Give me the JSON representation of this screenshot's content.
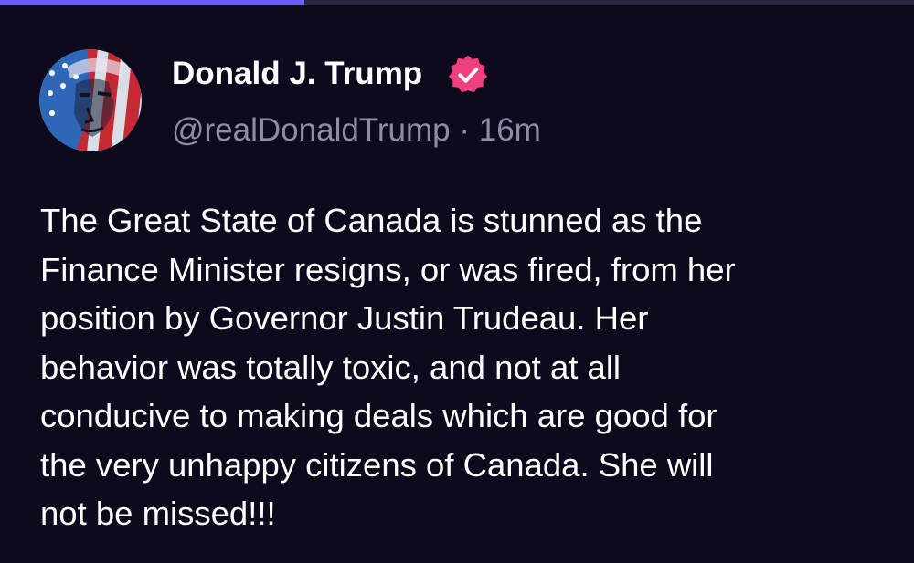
{
  "colors": {
    "background": "#0c0a1c",
    "progress_fill": "#6c5cf0",
    "progress_track": "#2a2840",
    "text_primary": "#ffffff",
    "text_secondary": "#8f8da6",
    "verified_badge": "#ee3f7e"
  },
  "progress": {
    "fraction": 0.333
  },
  "post": {
    "author": {
      "display_name": "Donald J. Trump",
      "handle": "@realDonaldTrump",
      "avatar_icon": "avatar-image",
      "verified_icon": "verified-badge-icon"
    },
    "separator": " · ",
    "timestamp": "16m",
    "body_lines": [
      "The Great State of Canada is stunned as the",
      "Finance Minister resigns, or was fired, from her",
      "position by Governor Justin Trudeau. Her",
      "behavior was totally toxic, and not at all",
      "conducive to making deals which are good for",
      "the very unhappy citizens of Canada. She will",
      "not be missed!!!"
    ]
  }
}
